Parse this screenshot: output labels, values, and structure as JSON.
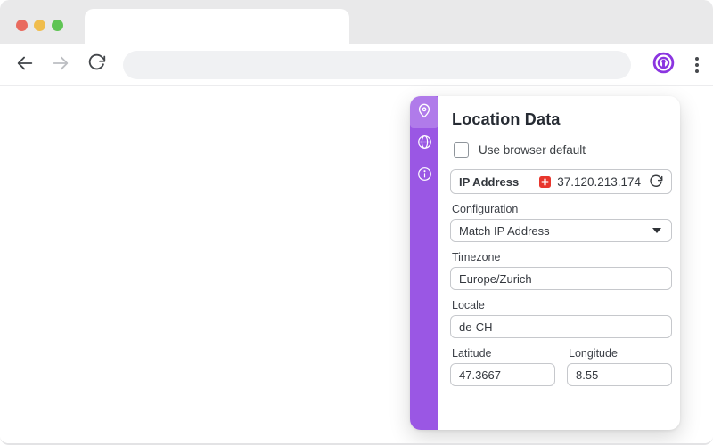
{
  "browser": {
    "traffic_lights": [
      {
        "name": "close",
        "color": "#e96b5f"
      },
      {
        "name": "minimize",
        "color": "#f0bd4d"
      },
      {
        "name": "maximize",
        "color": "#5fc454"
      }
    ],
    "toolbar_icons": [
      "back-arrow",
      "forward-arrow",
      "reload",
      "extension-logo",
      "kebab-menu"
    ],
    "address_bar": {
      "value": ""
    }
  },
  "popup": {
    "title": "Location Data",
    "sidebar_icons": [
      "location-pin",
      "globe",
      "info"
    ],
    "active_sidebar_icon": "location-pin",
    "checkbox": {
      "label": "Use browser default",
      "checked": false
    },
    "ip": {
      "label": "IP Address",
      "value": "37.120.213.174",
      "country_flag": "switzerland"
    },
    "configuration": {
      "label": "Configuration",
      "value": "Match IP Address"
    },
    "timezone": {
      "label": "Timezone",
      "value": "Europe/Zurich"
    },
    "locale": {
      "label": "Locale",
      "value": "de-CH"
    },
    "latitude": {
      "label": "Latitude",
      "value": "47.3667"
    },
    "longitude": {
      "label": "Longitude",
      "value": "8.55"
    }
  },
  "colors": {
    "accent_purple": "#9a57e4",
    "logo_purple": "#8b35e0",
    "swiss_flag_red": "#e8362d",
    "titlebar_gray": "#e9e9ea",
    "addressbar_gray": "#f0f1f3"
  }
}
